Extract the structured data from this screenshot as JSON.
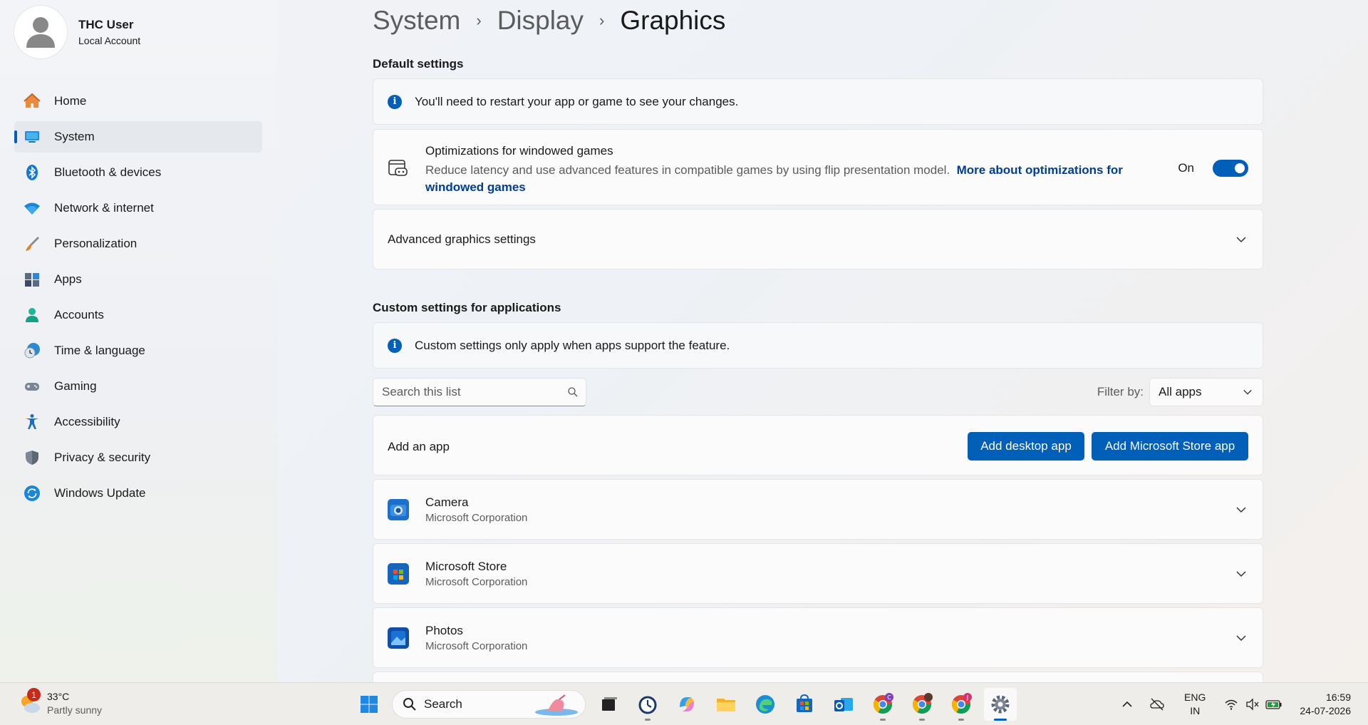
{
  "profile": {
    "name": "THC User",
    "account_type": "Local Account"
  },
  "nav": {
    "items": [
      {
        "label": "Home",
        "icon": "home-icon"
      },
      {
        "label": "System",
        "icon": "system-icon",
        "active": true
      },
      {
        "label": "Bluetooth & devices",
        "icon": "bluetooth-icon"
      },
      {
        "label": "Network & internet",
        "icon": "wifi-icon"
      },
      {
        "label": "Personalization",
        "icon": "brush-icon"
      },
      {
        "label": "Apps",
        "icon": "apps-icon"
      },
      {
        "label": "Accounts",
        "icon": "accounts-icon"
      },
      {
        "label": "Time & language",
        "icon": "time-language-icon"
      },
      {
        "label": "Gaming",
        "icon": "gamepad-icon"
      },
      {
        "label": "Accessibility",
        "icon": "accessibility-icon"
      },
      {
        "label": "Privacy & security",
        "icon": "shield-icon"
      },
      {
        "label": "Windows Update",
        "icon": "update-icon"
      }
    ]
  },
  "breadcrumb": {
    "items": [
      "System",
      "Display",
      "Graphics"
    ],
    "separator": "›"
  },
  "default_settings": {
    "title": "Default settings",
    "info_text": "You'll need to restart your app or game to see your changes.",
    "optimizations": {
      "title": "Optimizations for windowed games",
      "description": "Reduce latency and use advanced features in compatible games by using flip presentation model.",
      "link_text": "More about optimizations for windowed games",
      "toggle_label": "On",
      "toggle_on": true
    },
    "advanced_label": "Advanced graphics settings"
  },
  "custom_settings": {
    "title": "Custom settings for applications",
    "info_text": "Custom settings only apply when apps support the feature.",
    "search_placeholder": "Search this list",
    "filter_label": "Filter by:",
    "filter_value": "All apps",
    "add_app_label": "Add an app",
    "add_desktop_button": "Add desktop app",
    "add_store_button": "Add Microsoft Store app",
    "apps": [
      {
        "name": "Camera",
        "publisher": "Microsoft Corporation",
        "icon": "camera-icon"
      },
      {
        "name": "Microsoft Store",
        "publisher": "Microsoft Corporation",
        "icon": "store-icon"
      },
      {
        "name": "Photos",
        "publisher": "Microsoft Corporation",
        "icon": "photos-icon"
      }
    ]
  },
  "taskbar": {
    "weather": {
      "temp": "33°C",
      "desc": "Partly sunny",
      "badge": "1"
    },
    "search_label": "Search",
    "language": {
      "line1": "ENG",
      "line2": "IN"
    },
    "clock": {
      "time": "16:59",
      "date": "24-07-2026"
    },
    "chrome_badges": [
      "C",
      "",
      "J"
    ]
  },
  "colors": {
    "accent": "#005fb8",
    "link": "#003e92"
  }
}
